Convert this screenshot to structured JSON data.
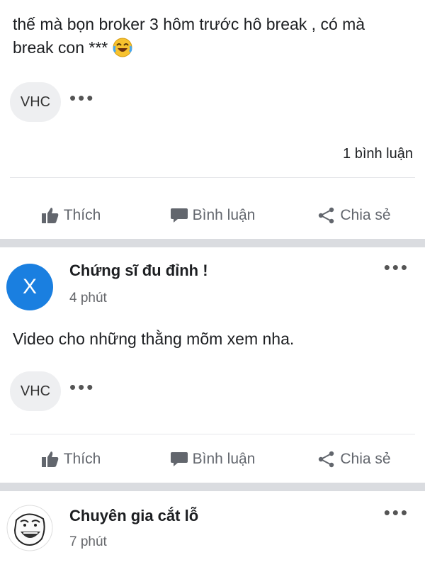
{
  "post1": {
    "text_line1": "thế mà bọn broker 3 hôm trước hô break , có mà",
    "text_line2": "break con ***",
    "emoji": "laughing-tears-emoji",
    "tag": "VHC",
    "more": "•••",
    "comment_count": "1 bình luận"
  },
  "post2": {
    "avatar_letter": "X",
    "avatar_color": "#1a7fe0",
    "author": "Chứng sĩ đu đỉnh !",
    "time": "4 phút",
    "text": "Video cho những thằng mõm xem nha.",
    "tag": "VHC",
    "more": "•••"
  },
  "post3": {
    "author": "Chuyên gia cắt lỗ",
    "time": "7 phút",
    "more": "•••",
    "avatar": "troll-face-avatar"
  },
  "actions": {
    "like": "Thích",
    "comment": "Bình luận",
    "share": "Chia sẻ"
  },
  "colors": {
    "action_gray": "#62666d",
    "divider": "#dadce0",
    "chip_bg": "#eeeff1"
  }
}
